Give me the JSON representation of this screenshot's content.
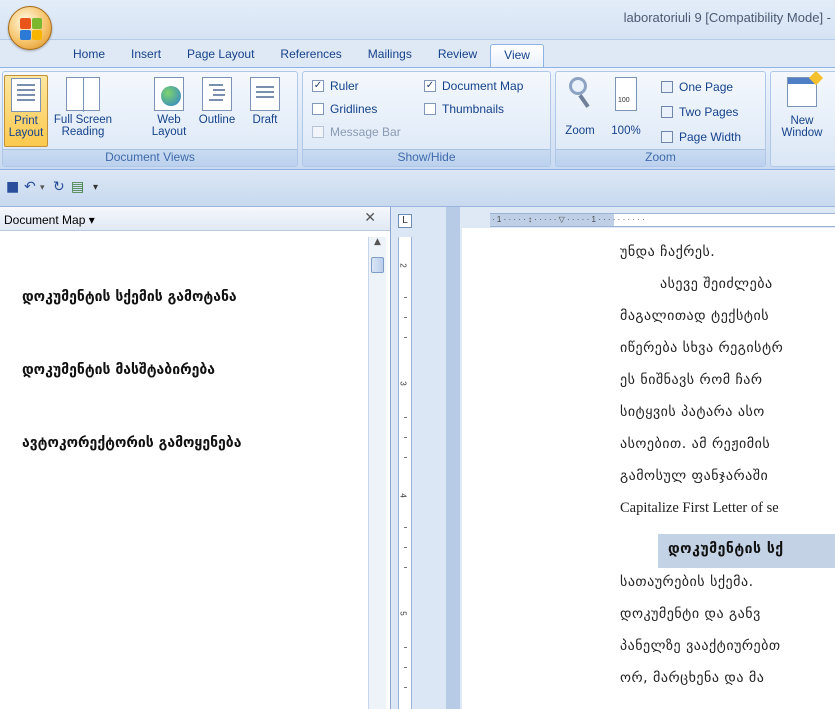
{
  "window": {
    "title": "laboratoriuli 9 [Compatibility Mode] -"
  },
  "tabs": [
    "Home",
    "Insert",
    "Page Layout",
    "References",
    "Mailings",
    "Review",
    "View"
  ],
  "active_tab": "View",
  "ribbon": {
    "document_views": {
      "label": "Document Views",
      "buttons": [
        {
          "line1": "Print",
          "line2": "Layout",
          "active": true
        },
        {
          "line1": "Full Screen",
          "line2": "Reading",
          "active": false
        },
        {
          "line1": "Web",
          "line2": "Layout",
          "active": false
        },
        {
          "line1": "Outline",
          "line2": "",
          "active": false
        },
        {
          "line1": "Draft",
          "line2": "",
          "active": false
        }
      ]
    },
    "show_hide": {
      "label": "Show/Hide",
      "ruler": {
        "label": "Ruler",
        "checked": true
      },
      "document_map": {
        "label": "Document Map",
        "checked": true
      },
      "gridlines": {
        "label": "Gridlines",
        "checked": false
      },
      "thumbnails": {
        "label": "Thumbnails",
        "checked": false
      },
      "message_bar": {
        "label": "Message Bar",
        "checked": false,
        "disabled": true
      }
    },
    "zoom": {
      "label": "Zoom",
      "zoom_label": "Zoom",
      "percent_label": "100%",
      "one_page": "One Page",
      "two_pages": "Two Pages",
      "page_width": "Page Width"
    },
    "window": {
      "new_window_line1": "New",
      "new_window_line2": "Window"
    }
  },
  "document_map": {
    "title": "Document Map",
    "items": [
      "დოკუმენტის სქემის გამოტანა",
      "დოკუმენტის მასშტაბირება",
      "ავტოკორექტორის გამოყენება"
    ]
  },
  "ruler": {
    "vertical_numbers": [
      "2",
      "3",
      "4",
      "5"
    ],
    "horizontal_text": "· 1 · · · · · ↕ · · · · · ▽ · · · · · 1 · · · · · · · · · ·"
  },
  "document": {
    "lines": [
      "უნდა ჩაქრეს.",
      "ასევე შეიძლება",
      "მაგალითად ტექსტის",
      "იწერება სხვა რეგისტრ",
      "ეს ნიშნავს რომ ჩარ",
      "სიტყვის პატარა ასო",
      "ასოებით. ამ რეჟიმის",
      "გამოსულ ფანჯარაში",
      "Capitalize First Letter of se"
    ],
    "heading": "დოკუმენტის სქ",
    "lines_after": [
      "სათაურების სქემა.",
      "დოკუმენტი და განვ",
      "პანელზე ვააქტიურებთ",
      "ორ, მარცხენა და მა"
    ]
  }
}
